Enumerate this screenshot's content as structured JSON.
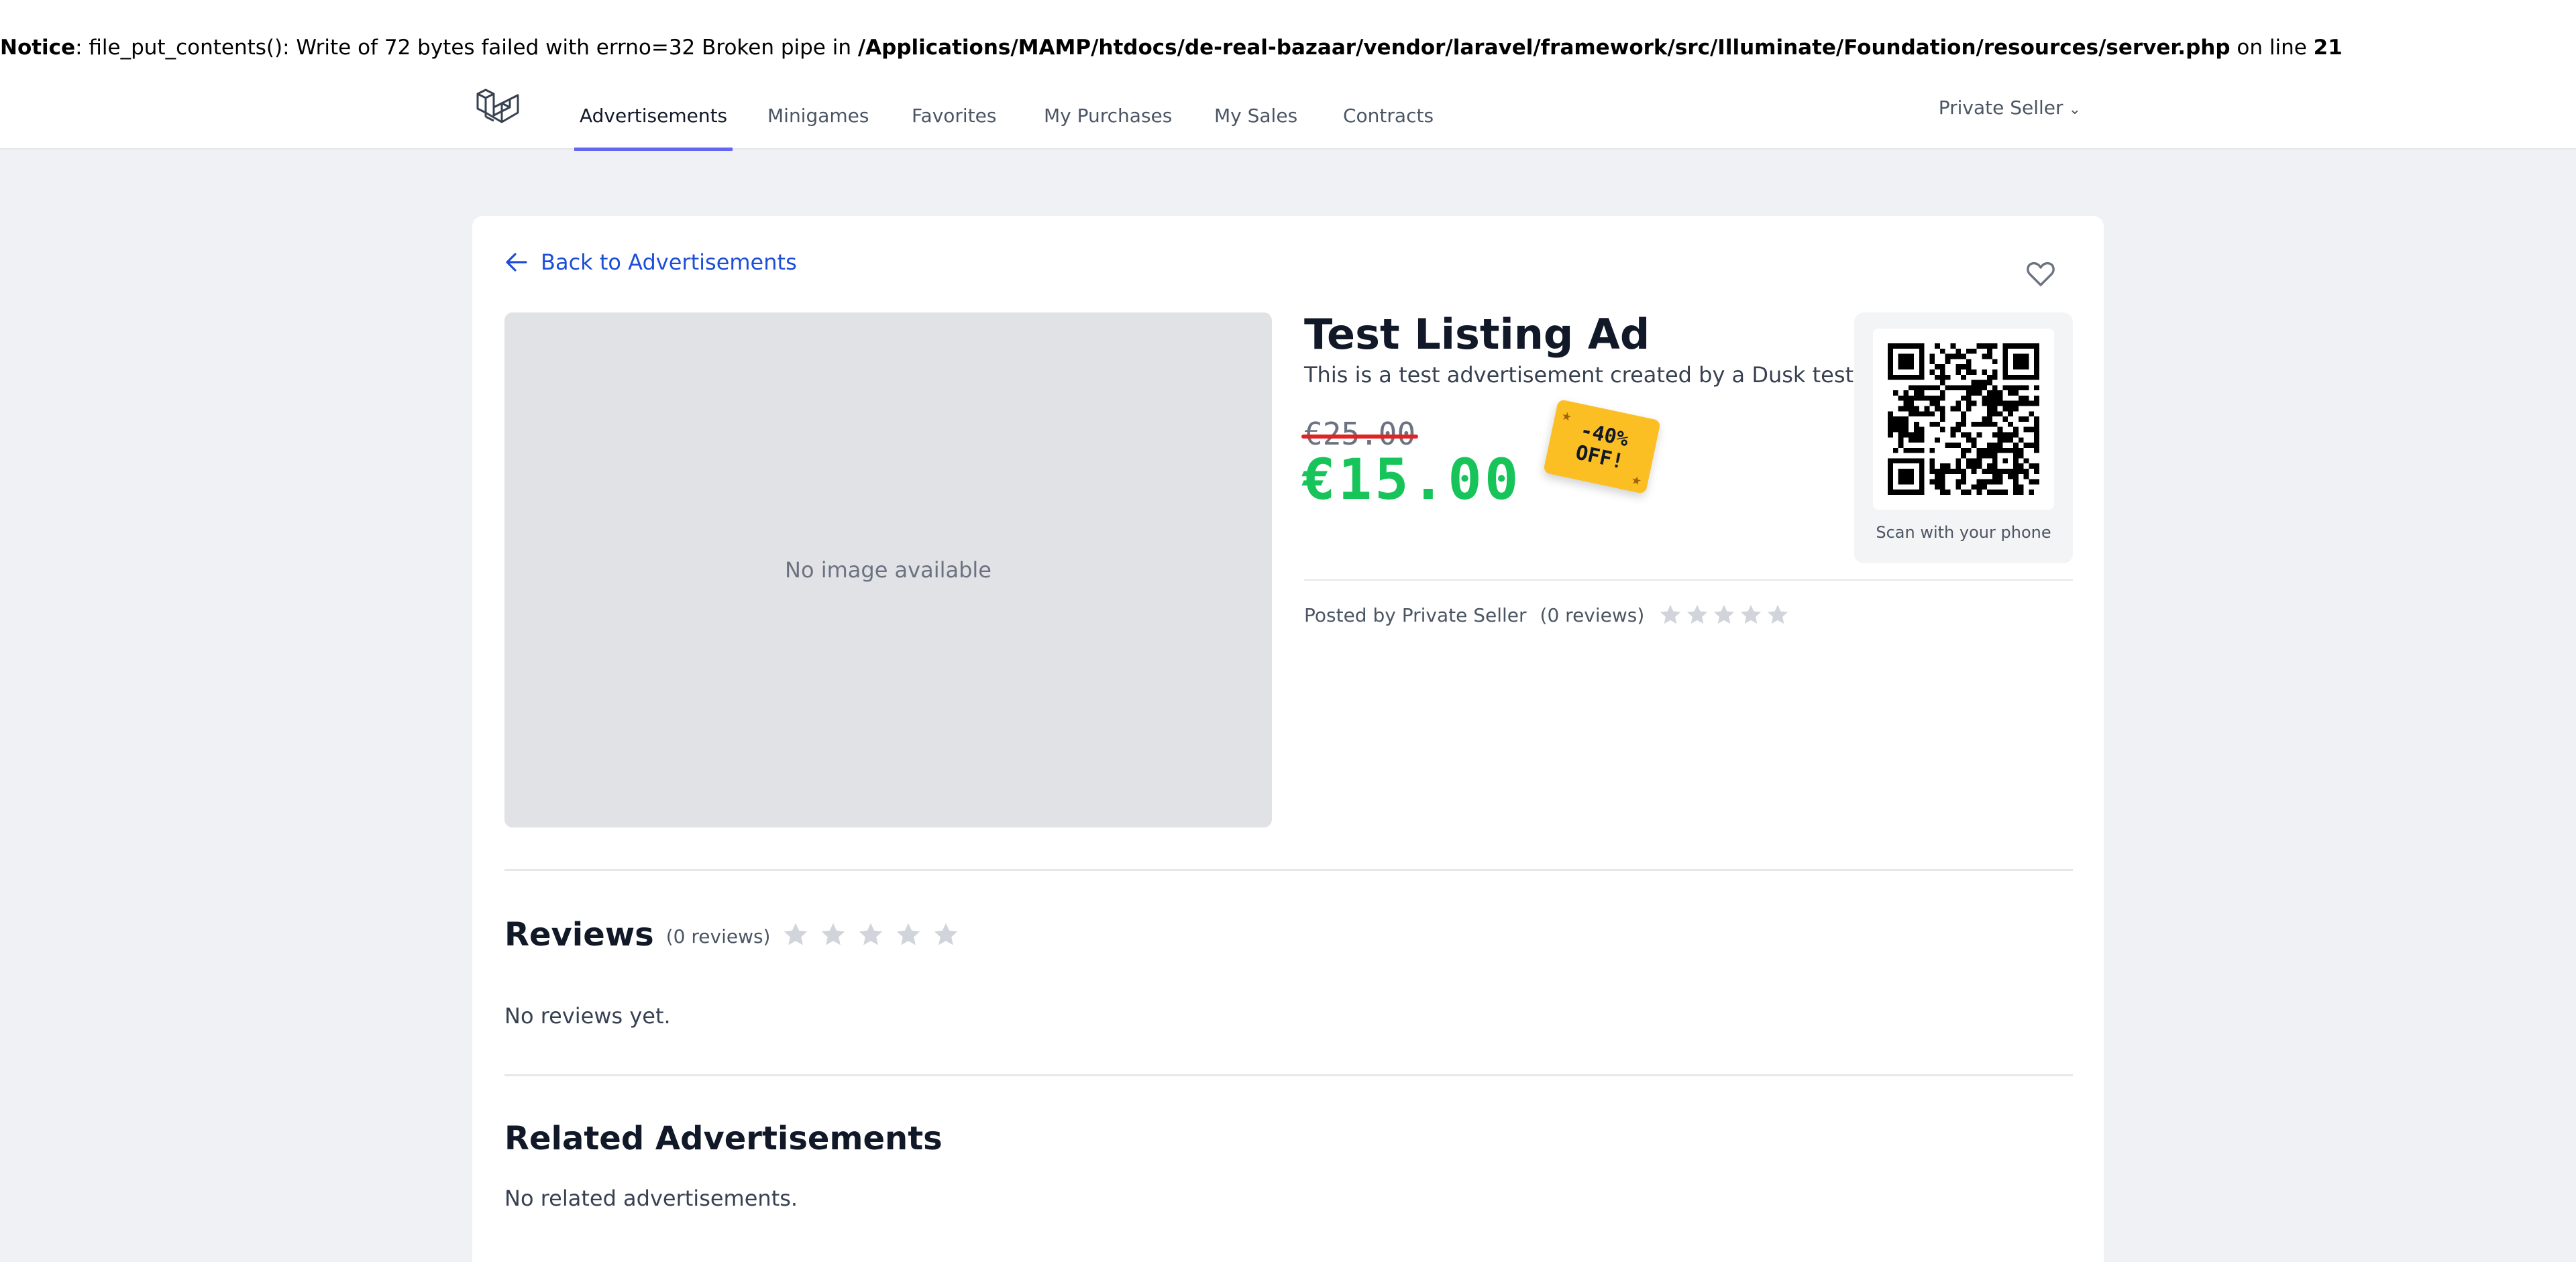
{
  "notice": {
    "label": "Notice",
    "message": ": file_put_contents(): Write of 72 bytes failed with errno=32 Broken pipe in ",
    "path": "/Applications/MAMP/htdocs/de-real-bazaar/vendor/laravel/framework/src/Illuminate/Foundation/resources/server.php",
    "line_text": " on line ",
    "line_number": "21"
  },
  "nav": {
    "logo_icon": "laravel-logo-icon",
    "items": [
      {
        "label": "Advertisements",
        "active": true
      },
      {
        "label": "Minigames",
        "active": false
      },
      {
        "label": "Favorites",
        "active": false
      },
      {
        "label": "My Purchases",
        "active": false
      },
      {
        "label": "My Sales",
        "active": false
      },
      {
        "label": "Contracts",
        "active": false
      }
    ],
    "user": {
      "name": "Private Seller",
      "icon": "chevron-down-icon"
    },
    "active_color": "#6366f1"
  },
  "listing": {
    "back_label": "Back to Advertisements",
    "image_placeholder": "No image available",
    "title": "Test Listing Ad",
    "description": "This is a test advertisement created by a Dusk test.",
    "old_price": "€25.00",
    "price": "€15.00",
    "discount_line1": "-40%",
    "discount_line2": "OFF!",
    "favorite_icon": "heart-icon",
    "qr_caption": "Scan with your phone",
    "posted_by": "Posted by Private Seller",
    "reviews_count": "(0 reviews)",
    "rating": 0,
    "price_color": "#16c45a",
    "badge_color": "#fbbf24"
  },
  "reviews": {
    "heading": "Reviews",
    "count": "(0 reviews)",
    "empty": "No reviews yet."
  },
  "related": {
    "heading": "Related Advertisements",
    "empty": "No related advertisements."
  }
}
